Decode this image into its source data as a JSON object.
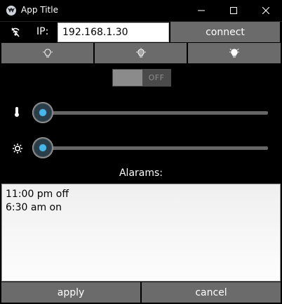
{
  "window": {
    "title": "App Title"
  },
  "ip": {
    "label": "IP:",
    "value": "192.168.1.30",
    "connect_label": "connect"
  },
  "lights": [
    {
      "icon": "bulb-low-icon"
    },
    {
      "icon": "bulb-medium-icon"
    },
    {
      "icon": "bulb-high-icon"
    }
  ],
  "toggle": {
    "state_label": "OFF",
    "on": false
  },
  "sliders": [
    {
      "icon": "thermometer-icon",
      "value": 0
    },
    {
      "icon": "brightness-icon",
      "value": 0
    }
  ],
  "alarms": {
    "label": "Alarams:",
    "text": "11:00 pm off\n6:30 am on"
  },
  "actions": {
    "apply_label": "apply",
    "cancel_label": "cancel"
  }
}
